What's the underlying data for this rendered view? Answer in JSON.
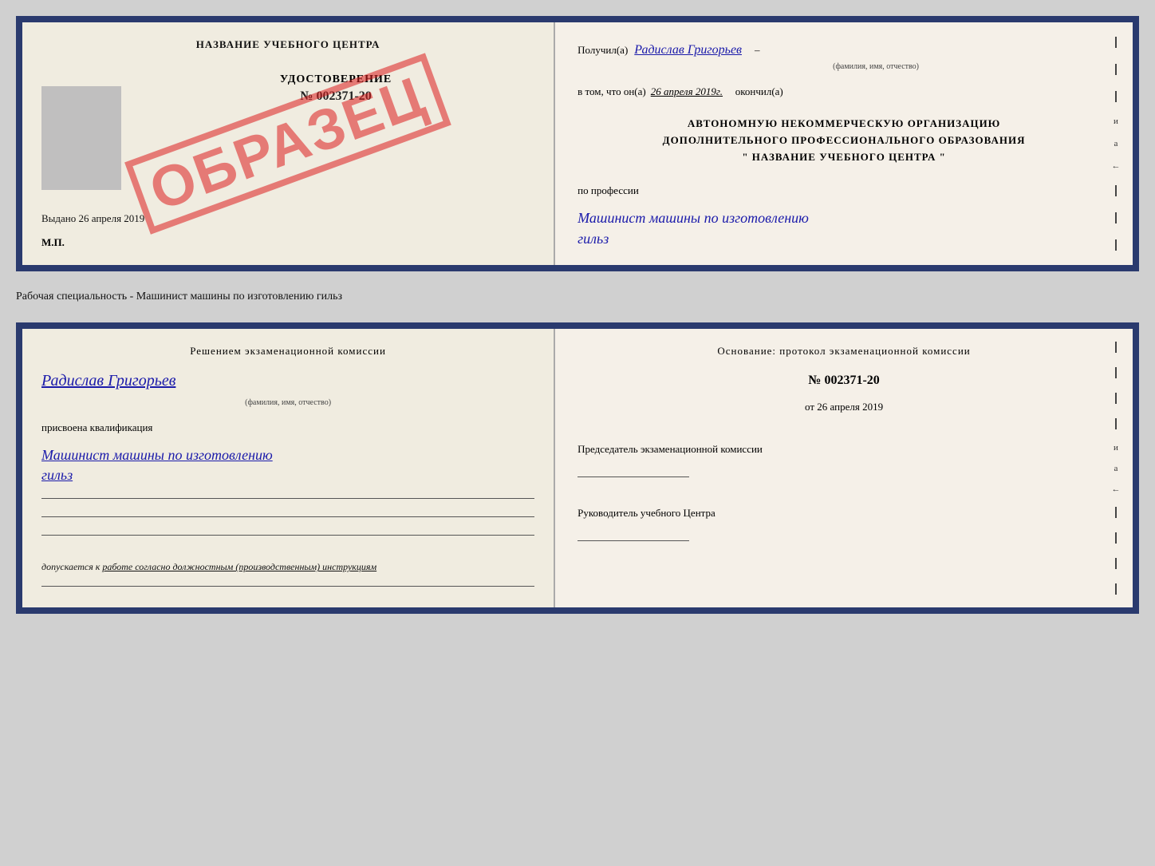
{
  "top_doc": {
    "left": {
      "center_title": "НАЗВАНИЕ УЧЕБНОГО ЦЕНТРА",
      "photo_alt": "фото",
      "udostoverenie_title": "УДОСТОВЕРЕНИЕ",
      "udostoverenie_number": "№ 002371-20",
      "vydano_label": "Выдано",
      "vydano_date": "26 апреля 2019",
      "mp_label": "М.П.",
      "stamp_text": "ОБРАЗЕЦ"
    },
    "right": {
      "poluchil_label": "Получил(а)",
      "poluchil_name": "Радислав Григорьев",
      "famil_hint": "(фамилия, имя, отчество)",
      "vtom_label": "в том, что он(а)",
      "date_value": "26 апреля 2019г.",
      "okonchil_label": "окончил(а)",
      "org_line1": "АВТОНОМНУЮ НЕКОММЕРЧЕСКУЮ ОРГАНИЗАЦИЮ",
      "org_line2": "ДОПОЛНИТЕЛЬНОГО ПРОФЕССИОНАЛЬНОГО ОБРАЗОВАНИЯ",
      "org_line3": "\"   НАЗВАНИЕ УЧЕБНОГО ЦЕНТРА   \"",
      "po_professii_label": "по профессии",
      "profession_line1": "Машинист машины по изготовлению",
      "profession_line2": "гильз",
      "side_chars": [
        "–",
        "–",
        "–",
        "и",
        "а",
        "←",
        "–",
        "–",
        "–"
      ]
    }
  },
  "specialty_label": "Рабочая специальность - Машинист машины по изготовлению гильз",
  "bottom_doc": {
    "left": {
      "reshenem_title": "Решением  экзаменационной  комиссии",
      "person_name": "Радислав Григорьев",
      "famil_hint": "(фамилия, имя, отчество)",
      "prisvoena_label": "присвоена квалификация",
      "qual_line1": "Машинист  машины  по изготовлению",
      "qual_line2": "гильз",
      "dopuskaetsya_label": "допускается к",
      "dopusk_text": "работе согласно должностным (производственным) инструкциям"
    },
    "right": {
      "osnovanie_title": "Основание: протокол экзаменационной  комиссии",
      "protocol_number": "№  002371-20",
      "ot_label": "от",
      "ot_date": "26 апреля 2019",
      "predsedatel_label": "Председатель экзаменационной комиссии",
      "rukovoditel_label": "Руководитель учебного Центра",
      "side_chars": [
        "–",
        "–",
        "–",
        "–",
        "и",
        "а",
        "←",
        "–",
        "–",
        "–",
        "–"
      ]
    }
  }
}
